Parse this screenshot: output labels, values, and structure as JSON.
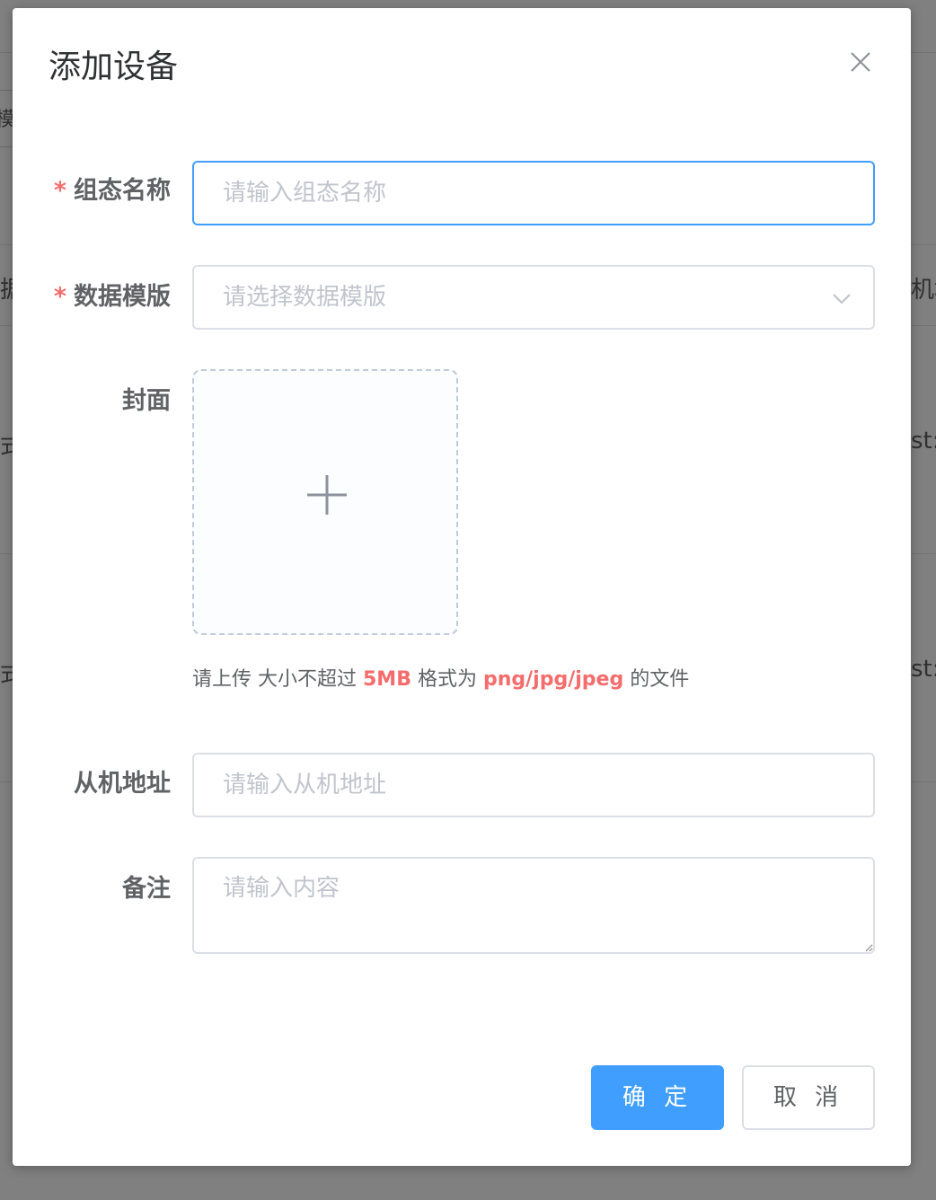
{
  "background": {
    "fragments": {
      "col_left_header": "据",
      "col_right_header": "机地",
      "row1_left": "式",
      "row1_right": "st:",
      "row2_left": "式",
      "row2_right": "st:",
      "search_left": "模"
    }
  },
  "dialog": {
    "title": "添加设备",
    "close_icon": "close-icon"
  },
  "form": {
    "config_name": {
      "label": "组态名称",
      "required_mark": "*",
      "placeholder": "请输入组态名称",
      "value": ""
    },
    "data_template": {
      "label": "数据模版",
      "required_mark": "*",
      "placeholder": "请选择数据模版",
      "arrow_icon": "chevron-down-icon"
    },
    "cover": {
      "label": "封面",
      "upload_icon": "plus-icon",
      "tip_prefix": "请上传 大小不超过 ",
      "tip_size": "5MB",
      "tip_middle": " 格式为 ",
      "tip_formats": "png/jpg/jpeg",
      "tip_suffix": " 的文件"
    },
    "slave_address": {
      "label": "从机地址",
      "placeholder": "请输入从机地址",
      "value": ""
    },
    "remark": {
      "label": "备注",
      "placeholder": "请输入内容",
      "value": ""
    }
  },
  "footer": {
    "confirm_label": "确 定",
    "cancel_label": "取 消"
  },
  "colors": {
    "primary": "#409eff",
    "danger": "#f56c6c",
    "text": "#606266",
    "placeholder": "#c0c4cc",
    "border": "#dcdfe6"
  }
}
